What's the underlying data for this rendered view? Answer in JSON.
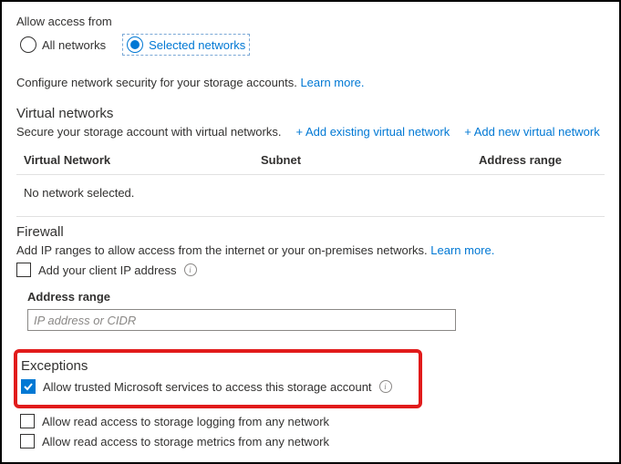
{
  "access": {
    "label": "Allow access from",
    "all": "All networks",
    "selected": "Selected networks"
  },
  "intro": {
    "text": "Configure network security for your storage accounts.",
    "learn": "Learn more."
  },
  "vnet": {
    "title": "Virtual networks",
    "desc": "Secure your storage account with virtual networks.",
    "add_existing": "+ Add existing virtual network",
    "add_new": "+ Add new virtual network",
    "col_vn": "Virtual Network",
    "col_sn": "Subnet",
    "col_ar": "Address range",
    "empty": "No network selected."
  },
  "firewall": {
    "title": "Firewall",
    "desc": "Add IP ranges to allow access from the internet or your on-premises networks.",
    "learn": "Learn more.",
    "add_client": "Add your client IP address",
    "addr_label": "Address range",
    "addr_placeholder": "IP address or CIDR"
  },
  "exceptions": {
    "title": "Exceptions",
    "trusted": "Allow trusted Microsoft services to access this storage account",
    "logging": "Allow read access to storage logging from any network",
    "metrics": "Allow read access to storage metrics from any network"
  }
}
